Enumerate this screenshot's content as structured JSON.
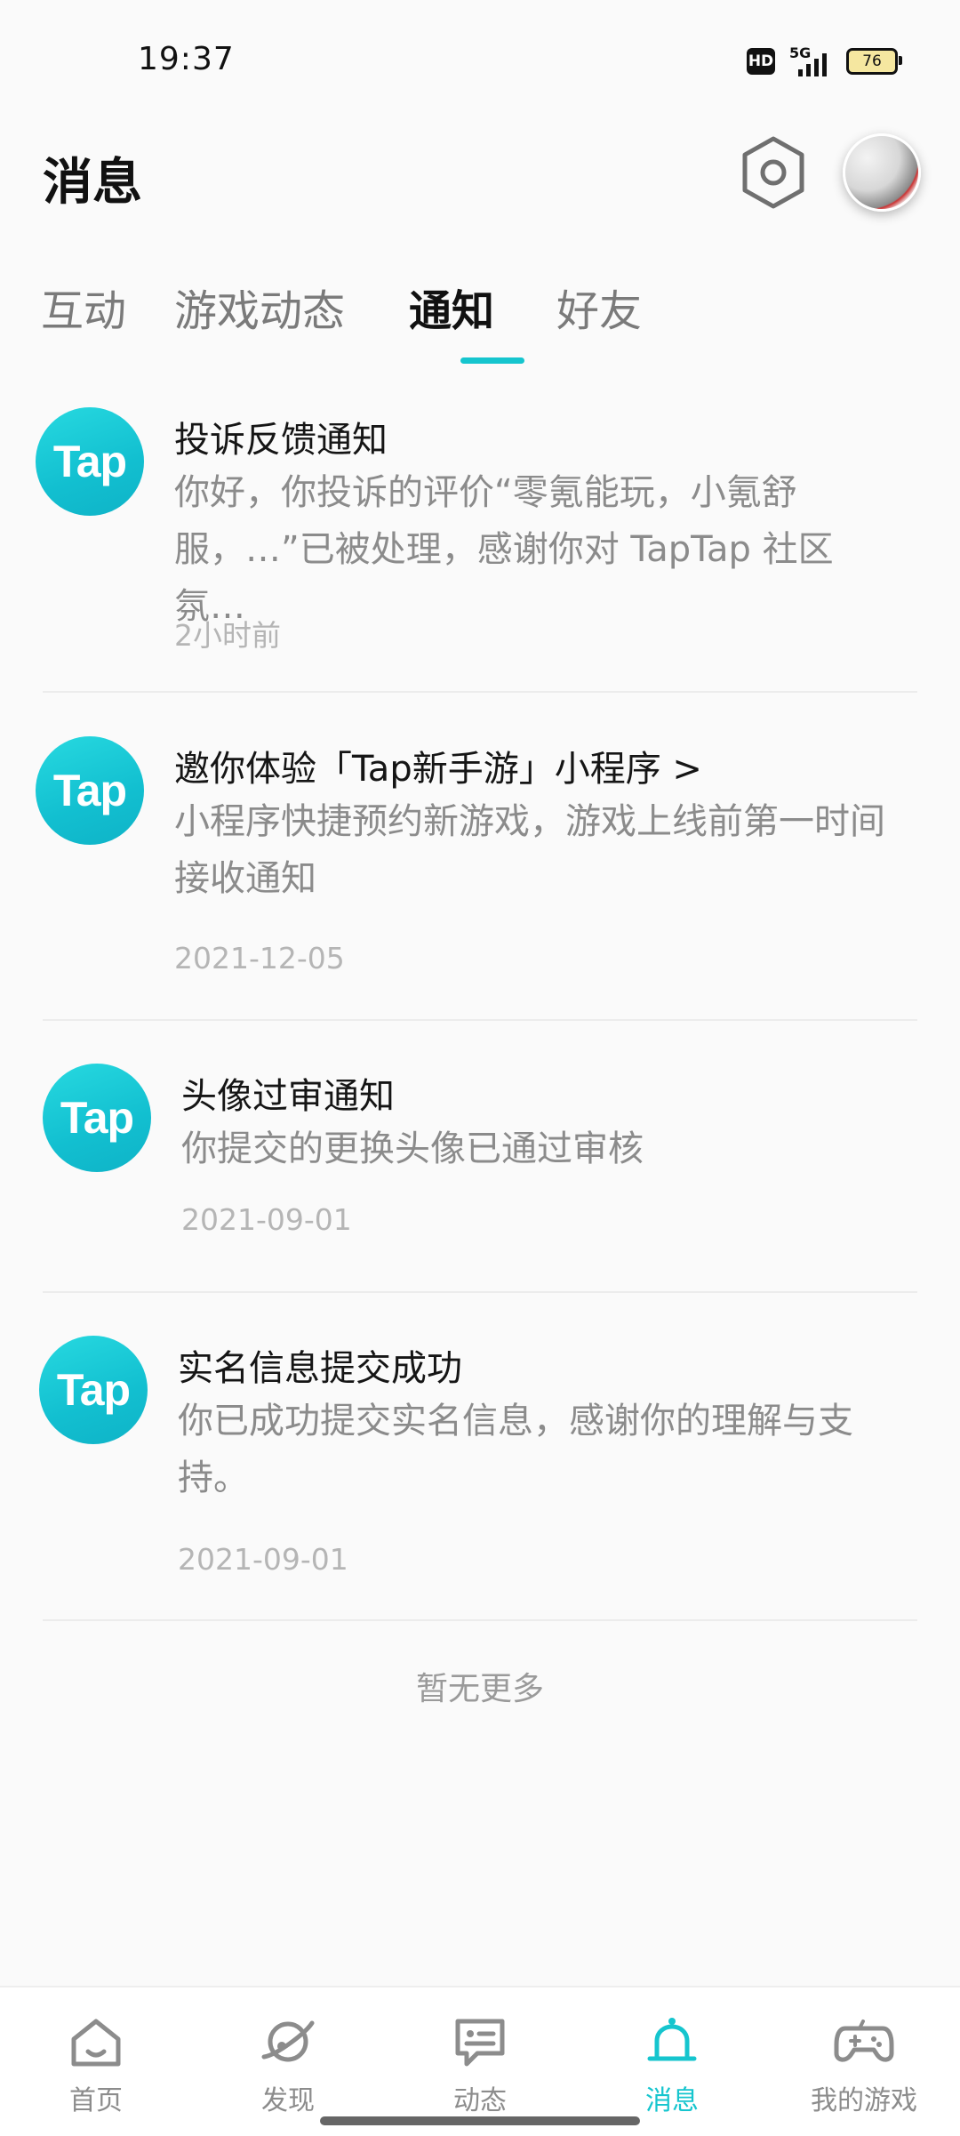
{
  "status_bar": {
    "time": "19:37",
    "hd": "HD",
    "network": "5G",
    "battery": "76"
  },
  "header": {
    "title": "消息"
  },
  "tabs": [
    {
      "label": "互动"
    },
    {
      "label": "游戏动态"
    },
    {
      "label": "通知",
      "active": true
    },
    {
      "label": "好友"
    }
  ],
  "notifications": [
    {
      "logo": "Tap",
      "title": "投诉反馈通知",
      "body": "你好，你投诉的评价“零氪能玩，小氪舒服，…”已被处理，感谢你对 TapTap 社区氛…",
      "time": "2小时前"
    },
    {
      "logo": "Tap",
      "title": "邀你体验「Tap新手游」小程序 >",
      "body": "小程序快捷预约新游戏，游戏上线前第一时间接收通知",
      "time": "2021-12-05"
    },
    {
      "logo": "Tap",
      "title": "头像过审通知",
      "body": "你提交的更换头像已通过审核",
      "time": "2021-09-01"
    },
    {
      "logo": "Tap",
      "title": "实名信息提交成功",
      "body": "你已成功提交实名信息，感谢你的理解与支持。",
      "time": "2021-09-01"
    }
  ],
  "footer_text": "暂无更多",
  "bottom_nav": [
    {
      "label": "首页",
      "icon": "home-icon"
    },
    {
      "label": "发现",
      "icon": "planet-icon"
    },
    {
      "label": "动态",
      "icon": "chat-icon"
    },
    {
      "label": "消息",
      "icon": "bell-icon",
      "active": true
    },
    {
      "label": "我的游戏",
      "icon": "gamepad-icon"
    }
  ],
  "colors": {
    "accent": "#15c5ce",
    "background": "#fafafa"
  }
}
